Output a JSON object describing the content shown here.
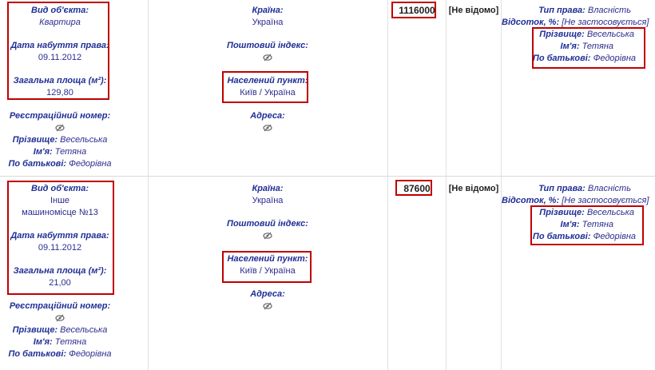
{
  "records": [
    {
      "object_type_label": "Вид об'єкта:",
      "object_type_value_line1": "Квартира",
      "object_type_value_line2": "",
      "acquisition_date_label": "Дата набуття права:",
      "acquisition_date_value": "09.11.2012",
      "total_area_label": "Загальна площа (м²):",
      "total_area_value": "129,80",
      "registration_number_label": "Реєстраційний номер:",
      "owner_surname_label": "Прізвище:",
      "owner_surname_value": "Весельська",
      "owner_name_label": "Ім'я:",
      "owner_name_value": "Тетяна",
      "owner_patronymic_label": "По батькові:",
      "owner_patronymic_value": "Федорівна",
      "country_label": "Країна:",
      "country_value": "Україна",
      "postal_code_label": "Поштовий індекс:",
      "locality_label": "Населений пункт:",
      "locality_value": "Київ / Україна",
      "address_label": "Адреса:",
      "cost": "1116000",
      "unknown": "[Не відомо]",
      "right_type_label": "Тип права:",
      "right_type_value": "Власність",
      "percent_label": "Відсоток, %:",
      "percent_value": "[Не застосовується]",
      "holder_surname_label": "Прізвище:",
      "holder_surname_value": "Весельська",
      "holder_name_label": "Ім'я:",
      "holder_name_value": "Тетяна",
      "holder_patronymic_label": "По батькові:",
      "holder_patronymic_value": "Федорівна"
    },
    {
      "object_type_label": "Вид об'єкта:",
      "object_type_value_line1": "Інше",
      "object_type_value_line2": "машиномісце №13",
      "acquisition_date_label": "Дата набуття права:",
      "acquisition_date_value": "09.11.2012",
      "total_area_label": "Загальна площа (м²):",
      "total_area_value": "21,00",
      "registration_number_label": "Реєстраційний номер:",
      "owner_surname_label": "Прізвище:",
      "owner_surname_value": "Весельська",
      "owner_name_label": "Ім'я:",
      "owner_name_value": "Тетяна",
      "owner_patronymic_label": "По батькові:",
      "owner_patronymic_value": "Федорівна",
      "country_label": "Країна:",
      "country_value": "Україна",
      "postal_code_label": "Поштовий індекс:",
      "locality_label": "Населений пункт:",
      "locality_value": "Київ / Україна",
      "address_label": "Адреса:",
      "cost": "87600",
      "unknown": "[Не відомо]",
      "right_type_label": "Тип права:",
      "right_type_value": "Власність",
      "percent_label": "Відсоток, %:",
      "percent_value": "[Не застосовується]",
      "holder_surname_label": "Прізвище:",
      "holder_surname_value": "Весельська",
      "holder_name_label": "Ім'я:",
      "holder_name_value": "Тетяна",
      "holder_patronymic_label": "По батькові:",
      "holder_patronymic_value": "Федорівна"
    }
  ],
  "colors": {
    "label": "#1f2f95",
    "value": "#2c2c8e",
    "highlight_box": "#c00000",
    "separator": "#d9d9d9"
  },
  "icons": {
    "hidden_value": "eye-slash-icon"
  }
}
